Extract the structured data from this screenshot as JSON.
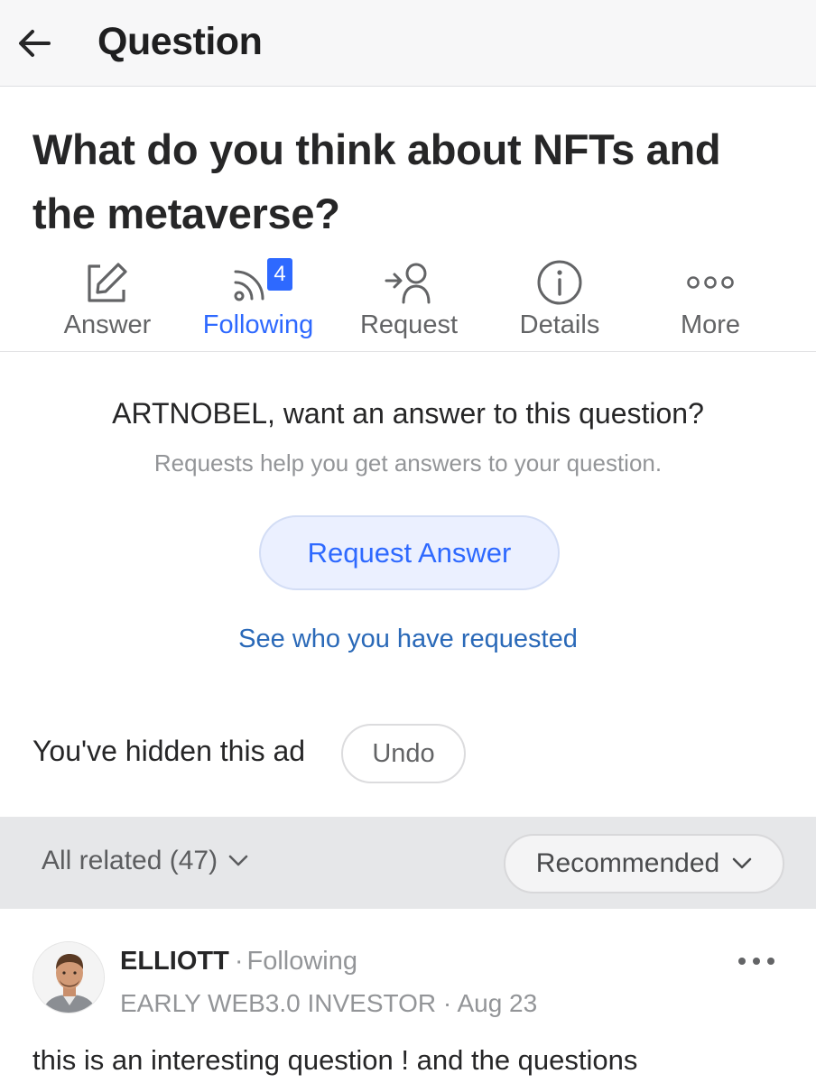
{
  "header": {
    "title": "Question",
    "back_icon": "arrow-left-icon"
  },
  "question": {
    "title": "What do you think about NFTs and the metaverse?"
  },
  "actions": [
    {
      "label": "Answer",
      "icon": "pencil-square-icon",
      "active": false
    },
    {
      "label": "Following",
      "icon": "rss-feed-icon",
      "active": true,
      "badge": "4"
    },
    {
      "label": "Request",
      "icon": "request-person-icon",
      "active": false
    },
    {
      "label": "Details",
      "icon": "info-circle-icon",
      "active": false
    },
    {
      "label": "More",
      "icon": "three-dots-icon",
      "active": false
    }
  ],
  "request_prompt": {
    "heading": "ARTNOBEL, want an answer to this question?",
    "subtext": "Requests help you get answers to your question.",
    "button_label": "Request Answer",
    "see_who_link": "See who you have requested"
  },
  "hidden_ad": {
    "text": "You've hidden this ad",
    "undo_label": "Undo"
  },
  "related": {
    "all_related_label": "All related (47)",
    "sort_label": "Recommended"
  },
  "answer": {
    "author_name": "ELLIOTT",
    "separator": "·",
    "follow_status": "Following",
    "credential": "EARLY WEB3.0 INVESTOR · Aug 23",
    "text": "this is an interesting question ! and the questions"
  },
  "colors": {
    "accent": "#2e69ff",
    "link": "#2a69b8",
    "muted": "#939598",
    "header_bg": "#f7f7f8",
    "related_bar_bg": "#e6e7e9"
  }
}
